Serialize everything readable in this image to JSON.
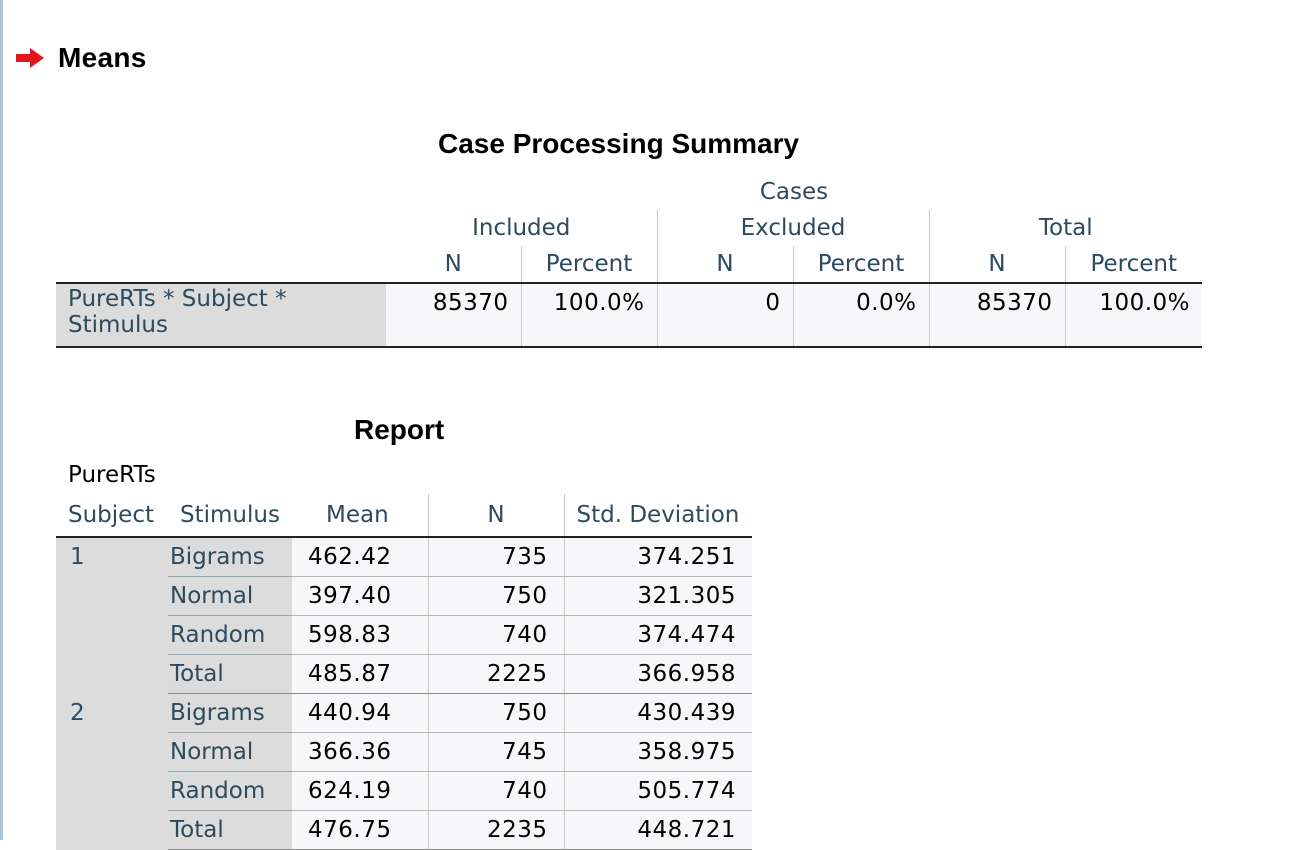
{
  "section": {
    "title": "Means"
  },
  "case_processing": {
    "title": "Case Processing Summary",
    "group_header": "Cases",
    "subgroups": [
      "Included",
      "Excluded",
      "Total"
    ],
    "columns": [
      "N",
      "Percent",
      "N",
      "Percent",
      "N",
      "Percent"
    ],
    "row": {
      "label": "PureRTs  * Subject * Stimulus",
      "values": [
        "85370",
        "100.0%",
        "0",
        "0.0%",
        "85370",
        "100.0%"
      ]
    }
  },
  "report": {
    "title": "Report",
    "variable": "PureRTs",
    "columns": [
      "Subject",
      "Stimulus",
      "Mean",
      "N",
      "Std. Deviation"
    ],
    "groups": [
      {
        "subject": "1",
        "rows": [
          {
            "stimulus": "Bigrams",
            "mean": "462.42",
            "n": "735",
            "sd": "374.251"
          },
          {
            "stimulus": "Normal",
            "mean": "397.40",
            "n": "750",
            "sd": "321.305"
          },
          {
            "stimulus": "Random",
            "mean": "598.83",
            "n": "740",
            "sd": "374.474"
          },
          {
            "stimulus": "Total",
            "mean": "485.87",
            "n": "2225",
            "sd": "366.958"
          }
        ]
      },
      {
        "subject": "2",
        "rows": [
          {
            "stimulus": "Bigrams",
            "mean": "440.94",
            "n": "750",
            "sd": "430.439"
          },
          {
            "stimulus": "Normal",
            "mean": "366.36",
            "n": "745",
            "sd": "358.975"
          },
          {
            "stimulus": "Random",
            "mean": "624.19",
            "n": "740",
            "sd": "505.774"
          },
          {
            "stimulus": "Total",
            "mean": "476.75",
            "n": "2235",
            "sd": "448.721"
          }
        ]
      }
    ]
  },
  "colors": {
    "arrow": "#e8141b",
    "header_text": "#2d4a5e",
    "stub_bg": "#dcdcdc",
    "cell_bg": "#f7f7f9"
  }
}
